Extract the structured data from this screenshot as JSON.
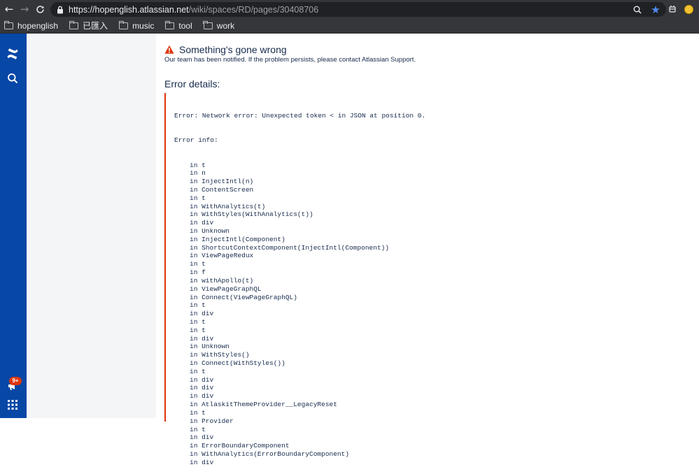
{
  "browser": {
    "url_host": "https://hopenglish.atlassian.net",
    "url_path": "/wiki/spaces/RD/pages/30408706",
    "bookmarks": [
      {
        "label": "hopenglish"
      },
      {
        "label": "已匯入"
      },
      {
        "label": "music"
      },
      {
        "label": "tool"
      },
      {
        "label": "work"
      }
    ]
  },
  "sidenav": {
    "notification_badge": "9+",
    "accent": "#0747a6"
  },
  "error": {
    "title": "Something's gone wrong",
    "message": "Our team has been notified. If the problem persists, please contact Atlassian Support.",
    "details_title": "Error details:",
    "error_line": "Error: Network error: Unexpected token < in JSON at position 0.",
    "info_label": "Error info:",
    "stack": [
      "in t",
      "in n",
      "in InjectIntl(n)",
      "in ContentScreen",
      "in t",
      "in WithAnalytics(t)",
      "in WithStyles(WithAnalytics(t))",
      "in div",
      "in Unknown",
      "in InjectIntl(Component)",
      "in ShortcutContextComponent(InjectIntl(Component))",
      "in ViewPageRedux",
      "in t",
      "in f",
      "in withApollo(t)",
      "in ViewPageGraphQL",
      "in Connect(ViewPageGraphQL)",
      "in t",
      "in div",
      "in t",
      "in t",
      "in div",
      "in Unknown",
      "in WithStyles()",
      "in Connect(WithStyles())",
      "in t",
      "in div",
      "in div",
      "in div",
      "in AtlaskitThemeProvider__LegacyReset",
      "in t",
      "in Provider",
      "in t",
      "in div",
      "in ErrorBoundaryComponent",
      "in WithAnalytics(ErrorBoundaryComponent)",
      "in div"
    ]
  }
}
